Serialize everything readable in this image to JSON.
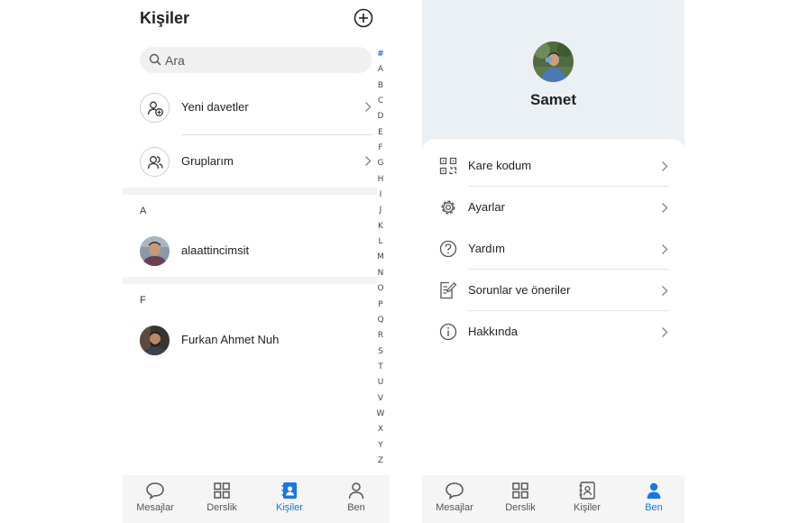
{
  "contacts_screen": {
    "title": "Kişiler",
    "search": {
      "placeholder": "Ara"
    },
    "menu_items": [
      {
        "label": "Yeni davetler",
        "icon": "person-add-icon"
      },
      {
        "label": "Gruplarım",
        "icon": "group-icon"
      }
    ],
    "sections": [
      {
        "letter": "A",
        "contacts": [
          {
            "name": "alaattincimsit"
          }
        ]
      },
      {
        "letter": "F",
        "contacts": [
          {
            "name": "Furkan Ahmet Nuh"
          }
        ]
      }
    ],
    "alphabet": [
      "#",
      "A",
      "B",
      "C",
      "D",
      "E",
      "F",
      "G",
      "H",
      "I",
      "J",
      "K",
      "L",
      "M",
      "N",
      "O",
      "P",
      "Q",
      "R",
      "S",
      "T",
      "U",
      "V",
      "W",
      "X",
      "Y",
      "Z"
    ],
    "tabs": [
      {
        "label": "Mesajlar",
        "icon": "chat-icon"
      },
      {
        "label": "Derslik",
        "icon": "grid-icon"
      },
      {
        "label": "Kişiler",
        "icon": "contacts-icon",
        "active": true
      },
      {
        "label": "Ben",
        "icon": "person-icon"
      }
    ]
  },
  "profile_screen": {
    "name": "Samet",
    "menu": [
      {
        "label": "Kare kodum",
        "icon": "qr-code-icon"
      },
      {
        "label": "Ayarlar",
        "icon": "gear-icon"
      },
      {
        "label": "Yardım",
        "icon": "help-icon"
      },
      {
        "label": "Sorunlar ve öneriler",
        "icon": "feedback-icon"
      },
      {
        "label": "Hakkında",
        "icon": "info-icon"
      }
    ],
    "tabs": [
      {
        "label": "Mesajlar",
        "icon": "chat-icon"
      },
      {
        "label": "Derslik",
        "icon": "grid-icon"
      },
      {
        "label": "Kişiler",
        "icon": "contacts-icon"
      },
      {
        "label": "Ben",
        "icon": "person-icon",
        "active": true
      }
    ]
  },
  "colors": {
    "accent": "#1677e8",
    "profile_header_bg": "#eaf0f3",
    "tabbar_bg": "#f5f5f5"
  }
}
